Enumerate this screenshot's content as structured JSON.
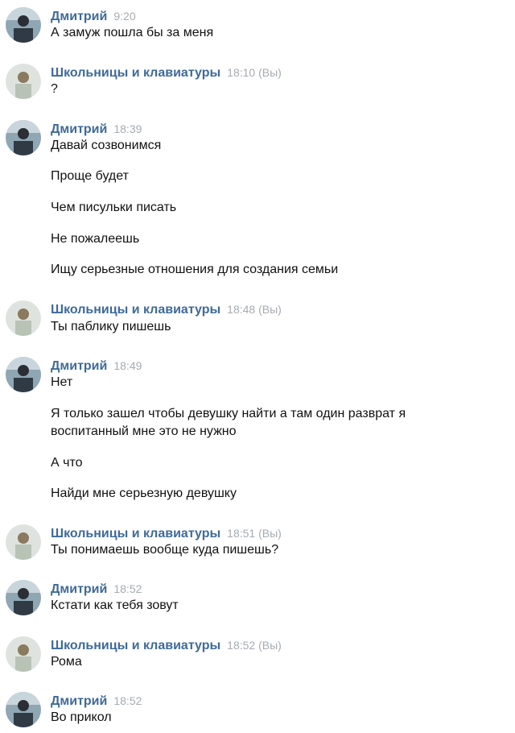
{
  "messages": [
    {
      "author": "Дмитрий",
      "time": "9:20",
      "lines": [
        "А замуж пошла бы за меня"
      ]
    },
    {
      "author": "Школьницы и клавиатуры",
      "time": "18:10 (Вы)",
      "lines": [
        "?"
      ]
    },
    {
      "author": "Дмитрий",
      "time": "18:39",
      "lines": [
        "Давай созвонимся",
        "Проще будет",
        "Чем писульки писать",
        "Не пожалеешь",
        "Ищу серьезные отношения для создания семьи"
      ]
    },
    {
      "author": "Школьницы и клавиатуры",
      "time": "18:48 (Вы)",
      "lines": [
        "Ты паблику пишешь"
      ]
    },
    {
      "author": "Дмитрий",
      "time": "18:49",
      "lines": [
        "Нет",
        "Я только зашел чтобы девушку найти а там один разврат я",
        "воспитанный мне это не нужно",
        "А что",
        "Найди мне серьезную девушку"
      ]
    },
    {
      "author": "Школьницы и клавиатуры",
      "time": "18:51 (Вы)",
      "lines": [
        "Ты понимаешь вообще куда пишешь?"
      ]
    },
    {
      "author": "Дмитрий",
      "time": "18:52",
      "lines": [
        "Кстати как тебя зовут"
      ]
    },
    {
      "author": "Школьницы и клавиатуры",
      "time": "18:52 (Вы)",
      "lines": [
        "Рома"
      ]
    },
    {
      "author": "Дмитрий",
      "time": "18:52",
      "lines": [
        "Во прикол"
      ]
    }
  ],
  "colors": {
    "author": "#3f6a99",
    "time": "#a6abb1",
    "text": "#111111"
  }
}
